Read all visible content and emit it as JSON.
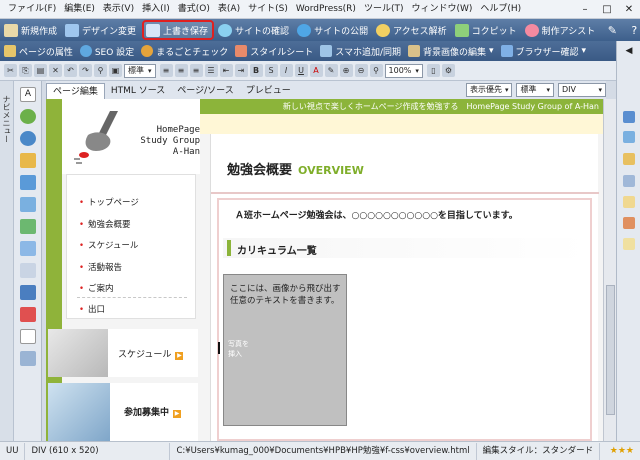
{
  "menubar": {
    "items": [
      "ファイル(F)",
      "編集(E)",
      "表示(V)",
      "挿入(I)",
      "書式(O)",
      "表(A)",
      "サイト(S)",
      "WordPress(R)",
      "ツール(T)",
      "ウィンドウ(W)",
      "ヘルプ(H)"
    ],
    "win_controls": [
      "–",
      "□",
      "✕"
    ]
  },
  "toolbar1": {
    "buttons": [
      {
        "label": "新規作成",
        "icon": "new-page-icon",
        "color": "#e9d9a8"
      },
      {
        "label": "デザイン変更",
        "icon": "design-icon",
        "color": "#9fc6ee"
      },
      {
        "label": "上書き保存",
        "icon": "save-icon",
        "color": "#d7e6f7"
      },
      {
        "label": "サイトの確認",
        "icon": "globe-check-icon",
        "color": "#8ad0f0"
      },
      {
        "label": "サイトの公開",
        "icon": "globe-publish-icon",
        "color": "#4fa6e6"
      },
      {
        "label": "アクセス解析",
        "icon": "analytics-icon",
        "color": "#f2d062"
      },
      {
        "label": "コクピット",
        "icon": "cockpit-icon",
        "color": "#8ed07a"
      },
      {
        "label": "制作アシスト",
        "icon": "assist-icon",
        "color": "#f58aa0"
      }
    ],
    "right_icons": [
      "pin-icon",
      "help-icon",
      "dropdown-icon"
    ]
  },
  "toolbar2": {
    "buttons": [
      {
        "label": "ページの属性",
        "icon": "page-attr-icon"
      },
      {
        "label": "SEO 設定",
        "icon": "seo-icon"
      },
      {
        "label": "まるごとチェック",
        "icon": "check-icon"
      },
      {
        "label": "スタイルシート",
        "icon": "stylesheet-icon"
      },
      {
        "label": "スマホ追加/同期",
        "icon": "smartphone-icon"
      },
      {
        "label": "背景画像の編集",
        "icon": "bg-image-icon"
      },
      {
        "label": "ブラウザー確認",
        "icon": "browser-icon"
      }
    ]
  },
  "toolbar3": {
    "style_select": "標準",
    "zoom": "100%",
    "format_buttons": [
      "B",
      "S",
      "I",
      "U",
      "A"
    ]
  },
  "left_panel": {
    "label": "ナビメニュー"
  },
  "editor": {
    "tabs": [
      "ページ編集",
      "HTML ソース",
      "ページ/ソース",
      "プレビュー"
    ],
    "options": [
      "表示優先",
      "標準",
      "DIV"
    ]
  },
  "page": {
    "top_banner": "新しい視点で楽しくホームページ作成を勉強する　HomePage Study Group of A-Han",
    "logo_lines": [
      "HomePage",
      "Study Group",
      "A-Han"
    ],
    "nav": [
      "トップページ",
      "勉強会概要",
      "スケジュール",
      "活動報告",
      "ご案内",
      "出口"
    ],
    "schedule_label": "スケジュール",
    "recruit_label": "参加募集中",
    "title": "勉強会概要",
    "title_en": "OVERVIEW",
    "lead": "Ａ班ホームページ勉強会は、○○○○○○○○○○○を目指しています。",
    "section_heading": "カリキュラム一覧",
    "box_text": "ここには、画像から飛び出す任意のテキストを書きます。",
    "photo_label": [
      "写真を",
      "挿入"
    ]
  },
  "status": {
    "mode": "UU",
    "element": "DIV (610 x 520)",
    "path": "C:¥Users¥kumag_000¥Documents¥HPB¥HP勉強¥f-css¥overview.html",
    "edit_style": "編集スタイル：スタンダード",
    "rating": "★★★"
  }
}
